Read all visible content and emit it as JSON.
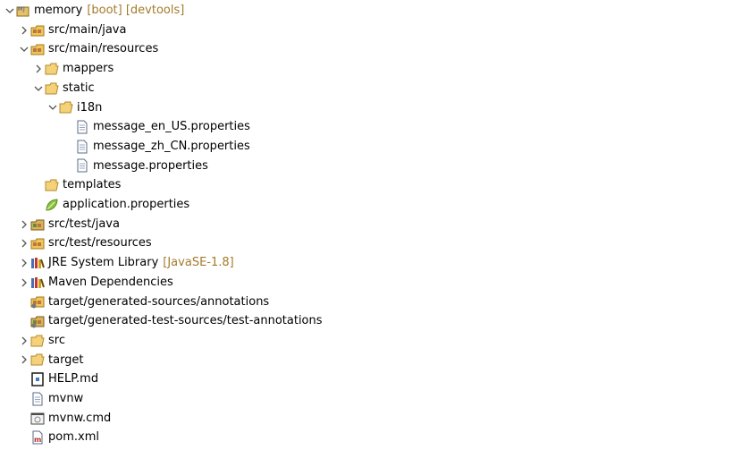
{
  "tree": {
    "project": {
      "label": "memory",
      "decoration": "[boot] [devtools]"
    },
    "items": [
      {
        "label": "src/main/java"
      },
      {
        "label": "src/main/resources"
      },
      {
        "label": "mappers"
      },
      {
        "label": "static"
      },
      {
        "label": "i18n"
      },
      {
        "label": "message_en_US.properties"
      },
      {
        "label": "message_zh_CN.properties"
      },
      {
        "label": "message.properties"
      },
      {
        "label": "templates"
      },
      {
        "label": "application.properties"
      },
      {
        "label": "src/test/java"
      },
      {
        "label": "src/test/resources"
      },
      {
        "label": "JRE System Library",
        "decoration": "[JavaSE-1.8]"
      },
      {
        "label": "Maven Dependencies"
      },
      {
        "label": "target/generated-sources/annotations"
      },
      {
        "label": "target/generated-test-sources/test-annotations"
      },
      {
        "label": "src"
      },
      {
        "label": "target"
      },
      {
        "label": "HELP.md"
      },
      {
        "label": "mvnw"
      },
      {
        "label": "mvnw.cmd"
      },
      {
        "label": "pom.xml"
      }
    ]
  },
  "colors": {
    "decoration": "#a47b2b",
    "folder": "#e8b84a",
    "package": "#b8860b"
  },
  "icons": {
    "project": "maven-project-icon",
    "source_folder": "package-folder-icon",
    "folder": "folder-icon",
    "properties_file": "text-file-icon",
    "spring_properties": "spring-leaf-icon",
    "library": "library-icon",
    "markdown": "markdown-file-icon",
    "shell": "file-icon",
    "cmd": "cmd-file-icon",
    "pom": "maven-pom-icon"
  }
}
